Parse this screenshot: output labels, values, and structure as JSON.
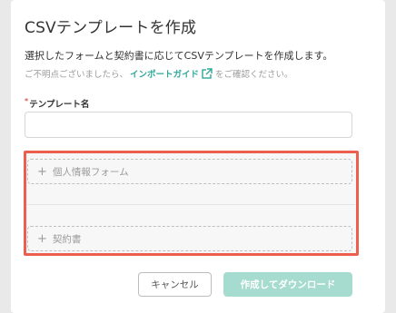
{
  "modal": {
    "title": "CSVテンプレートを作成",
    "description": "選択したフォームと契約書に応じてCSVテンプレートを作成します。",
    "hint_prefix": "ご不明点ございましたら、",
    "hint_link": "インポートガイド",
    "hint_suffix": "をご確認ください。"
  },
  "form": {
    "required_mark": "*",
    "name_label": "テンプレート名",
    "name_value": "",
    "name_placeholder": ""
  },
  "selectors": {
    "form_label": "個人情報フォーム",
    "contract_label": "契約書"
  },
  "actions": {
    "cancel_label": "キャンセル",
    "download_label": "作成してダウンロード"
  },
  "colors": {
    "accent": "#2fa898",
    "highlight_border": "#ec5e4d",
    "disabled_button": "#a6dccf"
  },
  "icons": {
    "external_link": "external-link-icon",
    "plus": "plus-icon"
  }
}
